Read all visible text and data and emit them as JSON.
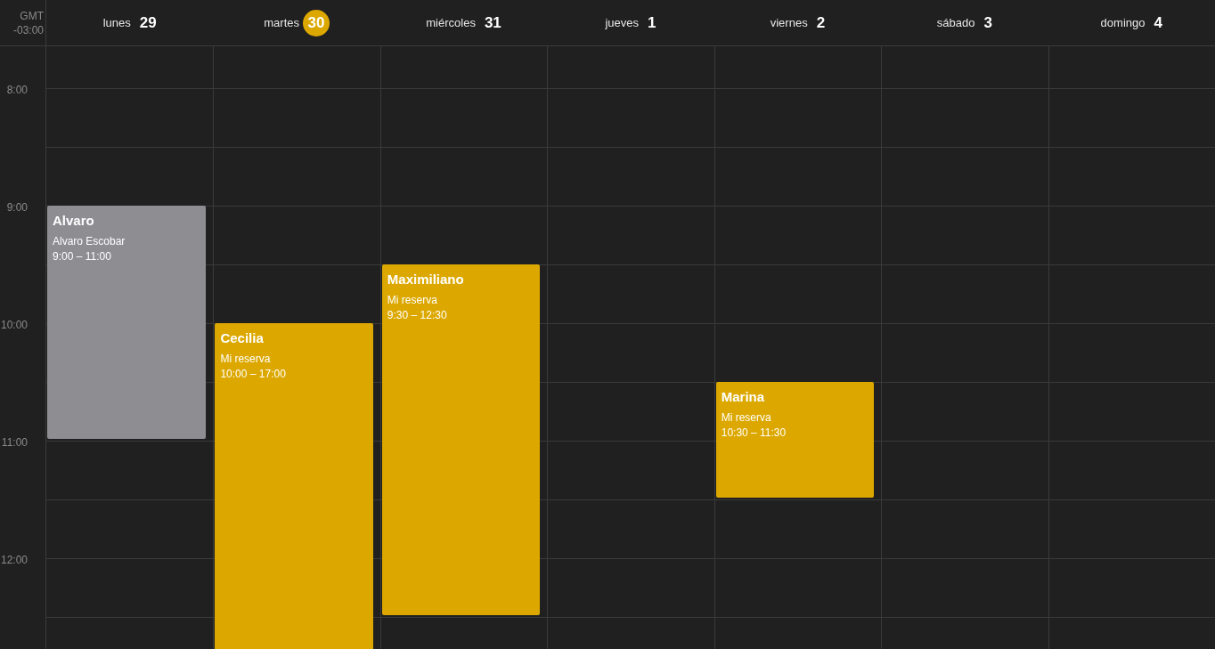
{
  "timezone": {
    "line_1": "GMT",
    "line_2": "-03:00"
  },
  "days": [
    {
      "name": "lunes",
      "number": "29",
      "selected": false,
      "events": [
        {
          "title": "Alvaro",
          "subtitle": "Alvaro Escobar",
          "time": "9:00 – 11:00",
          "color": "#8e8d92"
        }
      ]
    },
    {
      "name": "martes",
      "number": "30",
      "selected": true,
      "events": [
        {
          "title": "Cecilia",
          "subtitle": "Mi reserva",
          "time": "10:00 – 17:00",
          "color": "#dca800"
        }
      ]
    },
    {
      "name": "miércoles",
      "number": "31",
      "selected": false,
      "events": [
        {
          "title": "Maximiliano",
          "subtitle": "Mi reserva",
          "time": "9:30 – 12:30",
          "color": "#dca800"
        }
      ]
    },
    {
      "name": "jueves",
      "number": "1",
      "selected": false
    },
    {
      "name": "viernes",
      "number": "2",
      "selected": false,
      "events": [
        {
          "title": "Marina",
          "subtitle": "Mi reserva",
          "time": "10:30 – 11:30",
          "color": "#dca800"
        }
      ]
    },
    {
      "name": "sábado",
      "number": "3",
      "selected": false
    },
    {
      "name": "domingo",
      "number": "4",
      "selected": false
    }
  ],
  "hours": [
    "8:00",
    "9:00",
    "10:00",
    "11:00",
    "12:00"
  ]
}
